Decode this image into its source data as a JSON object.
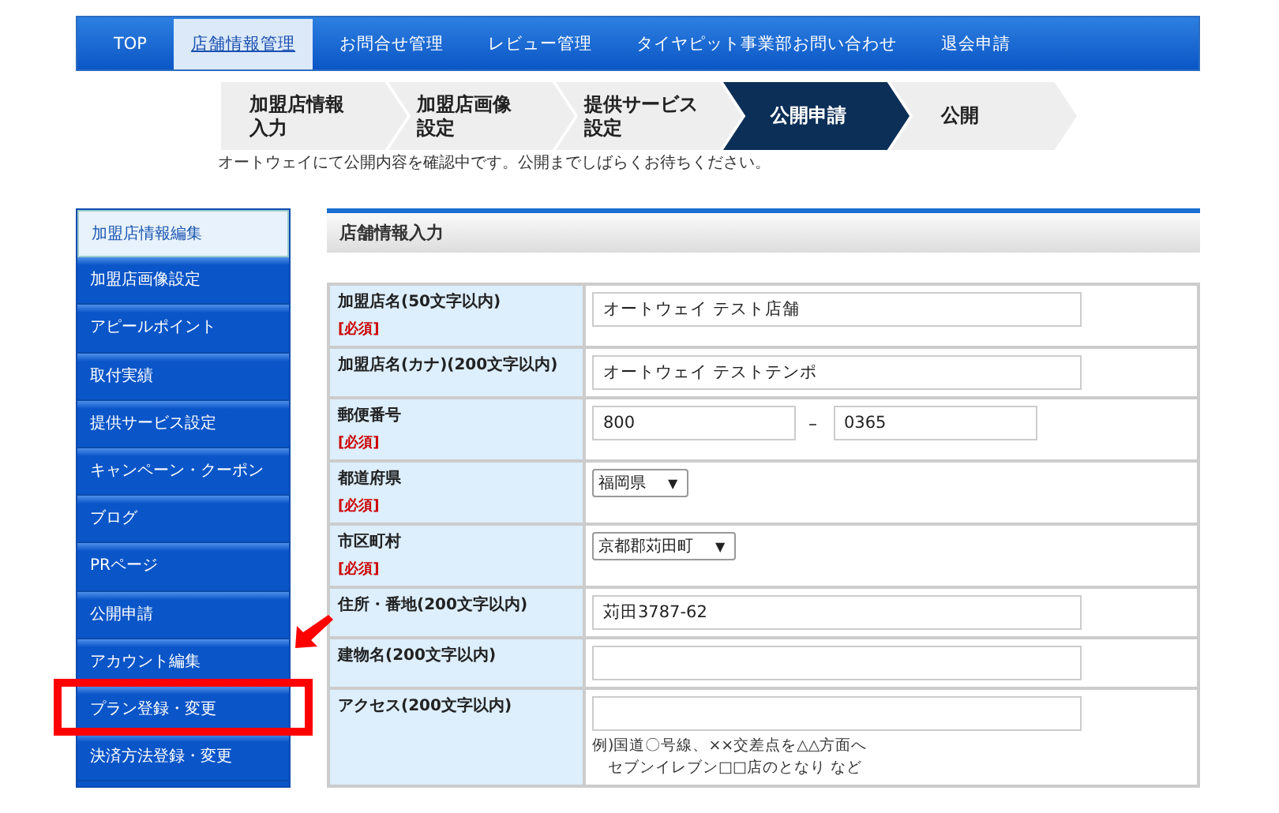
{
  "nav": [
    {
      "label": "TOP",
      "selected": false
    },
    {
      "label": "店舗情報管理",
      "selected": true
    },
    {
      "label": "お問合せ管理",
      "selected": false
    },
    {
      "label": "レビュー管理",
      "selected": false
    },
    {
      "label": "タイヤピット事業部お問い合わせ",
      "selected": false
    },
    {
      "label": "退会申請",
      "selected": false
    }
  ],
  "steps": [
    {
      "lines": [
        "加盟店情報",
        "入力"
      ],
      "selected": false
    },
    {
      "lines": [
        "加盟店画像",
        "設定"
      ],
      "selected": false
    },
    {
      "lines": [
        "提供サービス",
        "設定"
      ],
      "selected": false
    },
    {
      "lines": [
        "公開申請"
      ],
      "selected": true
    },
    {
      "lines": [
        "公開"
      ],
      "selected": false
    }
  ],
  "notice": "オートウェイにて公開内容を確認中です。公開までしばらくお待ちください。",
  "sidebar": {
    "items": [
      {
        "label": "加盟店情報編集",
        "selected": true
      },
      {
        "label": "加盟店画像設定",
        "selected": false
      },
      {
        "label": "アピールポイント",
        "selected": false
      },
      {
        "label": "取付実績",
        "selected": false
      },
      {
        "label": "提供サービス設定",
        "selected": false
      },
      {
        "label": "キャンペーン・クーポン",
        "selected": false
      },
      {
        "label": "ブログ",
        "selected": false
      },
      {
        "label": "PRページ",
        "selected": false
      },
      {
        "label": "公開申請",
        "selected": false
      },
      {
        "label": "アカウント編集",
        "selected": false
      },
      {
        "label": "プラン登録・変更",
        "selected": false,
        "highlighted": true
      },
      {
        "label": "決済方法登録・変更",
        "selected": false
      }
    ]
  },
  "section_title": "店舗情報入力",
  "form": [
    {
      "label": "加盟店名(50文字以内)",
      "required": "[必須]",
      "kind": "text",
      "value": "オートウェイ テスト店舗"
    },
    {
      "label": "加盟店名(カナ)(200文字以内)",
      "kind": "text",
      "value": "オートウェイ テストテンポ"
    },
    {
      "label": "郵便番号",
      "required": "[必須]",
      "kind": "zip",
      "values": [
        "800",
        "0365"
      ],
      "separator": "–"
    },
    {
      "label": "都道府県",
      "required": "[必須]",
      "kind": "select",
      "value": "福岡県",
      "caret": "▼"
    },
    {
      "label": "市区町村",
      "required": "[必須]",
      "kind": "select",
      "value": "京都郡苅田町",
      "caret": "▼"
    },
    {
      "label": "住所・番地(200文字以内)",
      "kind": "text",
      "value": "苅田3787-62"
    },
    {
      "label": "建物名(200文字以内)",
      "kind": "text"
    },
    {
      "label": "アクセス(200文字以内)",
      "kind": "text",
      "hints": [
        "例)国道〇号線、××交差点を△△方面へ",
        "セブンイレブン□□店のとなり など"
      ]
    }
  ]
}
